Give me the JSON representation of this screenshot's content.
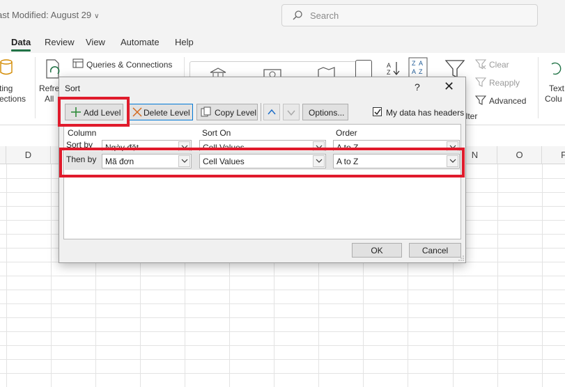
{
  "window": {
    "title": "ast Modified: August 29",
    "search_placeholder": "Search"
  },
  "ribbon_tabs": [
    "Data",
    "Review",
    "View",
    "Automate",
    "Help"
  ],
  "ribbon": {
    "left_partial_1": "ting",
    "left_partial_2": "ections",
    "refresh_partial_1": "Refre",
    "refresh_partial_2": "All",
    "queries_connections": "Queries & Connections",
    "clear": "Clear",
    "reapply": "Reapply",
    "advanced": "Advanced",
    "filter_partial": "ilter",
    "text_partial_1": "Text",
    "text_partial_2": "Colu"
  },
  "grid": {
    "columns_left": [
      "D"
    ],
    "columns_right": [
      "N",
      "O",
      "P"
    ]
  },
  "dialog": {
    "title": "Sort",
    "help": "?",
    "close": "✕",
    "toolbar": {
      "add_level": "Add Level",
      "delete_level": "Delete Level",
      "copy_level": "Copy Level",
      "options": "Options...",
      "my_data_has_headers": "My data has headers",
      "my_data_has_headers_checked": true
    },
    "headers": {
      "column": "Column",
      "sort_on": "Sort On",
      "order": "Order"
    },
    "rows": [
      {
        "label": "Sort by",
        "column": "Ngày đặt",
        "sort_on": "Cell Values",
        "order": "A to Z"
      },
      {
        "label": "Then by",
        "column": "Mã đơn",
        "sort_on": "Cell Values",
        "order": "A to Z"
      }
    ],
    "ok": "OK",
    "cancel": "Cancel"
  },
  "colors": {
    "highlight": "#e01b2c",
    "accent": "#217346",
    "focus": "#0078d7"
  }
}
